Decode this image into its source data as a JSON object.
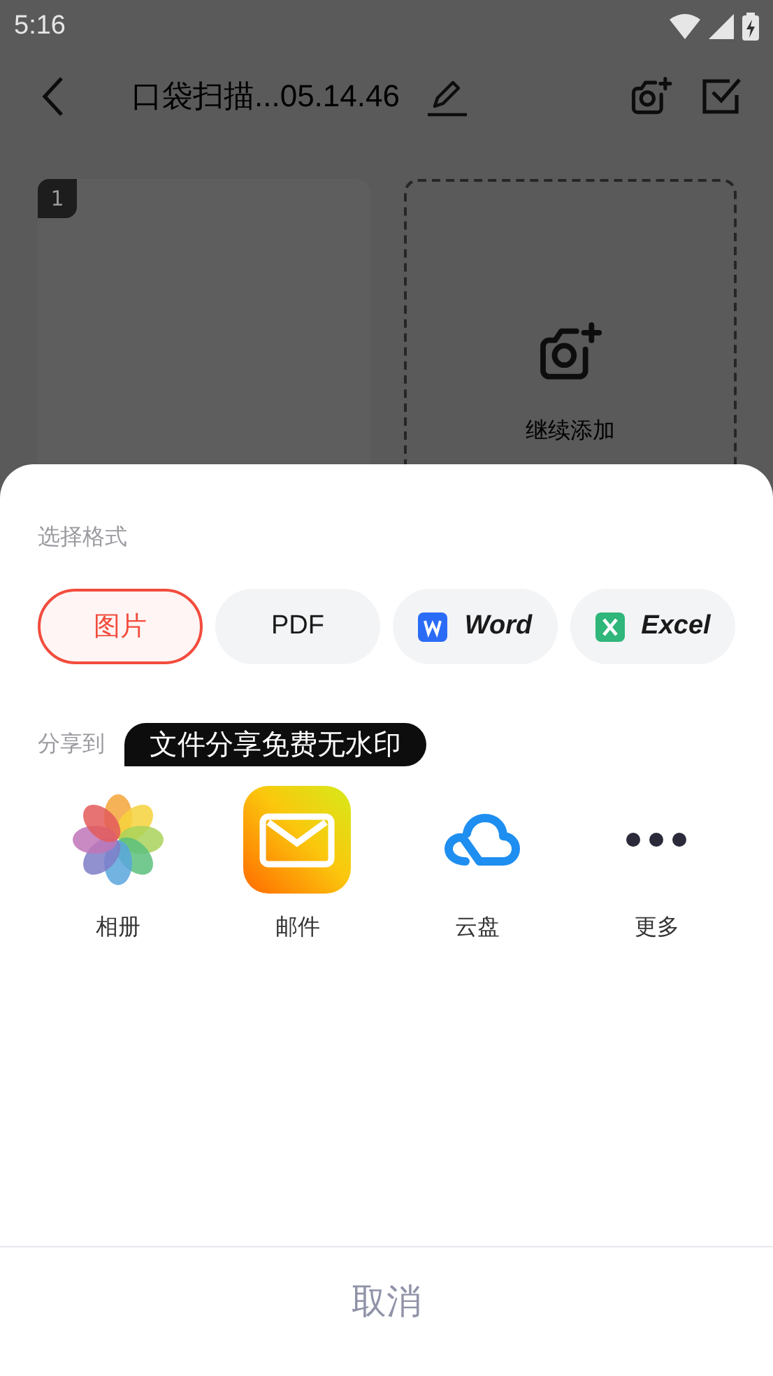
{
  "status_bar": {
    "time": "5:16"
  },
  "toolbar": {
    "title": "口袋扫描...05.14.46"
  },
  "pages": [
    {
      "number": "1"
    }
  ],
  "add_card": {
    "label": "继续添加"
  },
  "sheet": {
    "format_label": "选择格式",
    "formats": [
      {
        "kind": "image",
        "label": "图片",
        "selected": true
      },
      {
        "kind": "pdf",
        "label": "PDF",
        "selected": false
      },
      {
        "kind": "word",
        "label": "Word",
        "selected": false
      },
      {
        "kind": "excel",
        "label": "Excel",
        "selected": false
      }
    ],
    "share_label": "分享到",
    "promo": "文件分享免费无水印",
    "targets": [
      {
        "kind": "album",
        "label": "相册"
      },
      {
        "kind": "mail",
        "label": "邮件"
      },
      {
        "kind": "cloud",
        "label": "云盘"
      },
      {
        "kind": "more",
        "label": "更多"
      }
    ],
    "cancel": "取消"
  }
}
